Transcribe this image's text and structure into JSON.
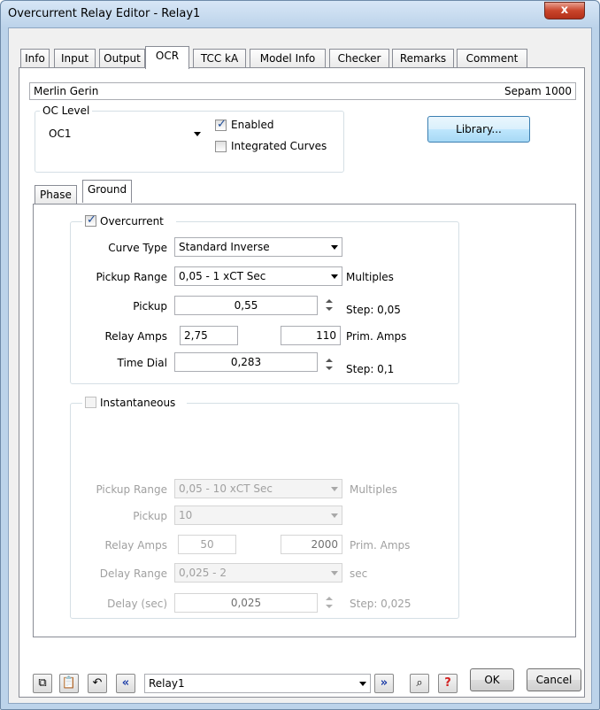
{
  "window": {
    "title": "Overcurrent Relay Editor - Relay1",
    "close_label": "x"
  },
  "tabs": [
    "Info",
    "Input",
    "Output",
    "OCR",
    "TCC kA",
    "Model Info",
    "Checker",
    "Remarks",
    "Comment"
  ],
  "active_tab": "OCR",
  "header": {
    "manufacturer": "Merlin Gerin",
    "model": "Sepam 1000"
  },
  "oc_level": {
    "group_label": "OC Level",
    "selected": "OC1",
    "enabled_label": "Enabled",
    "enabled_checked": true,
    "integrated_label": "Integrated Curves",
    "integrated_checked": false
  },
  "library_button": "Library...",
  "subtabs": [
    "Phase",
    "Ground"
  ],
  "active_subtab": "Ground",
  "overcurrent": {
    "label": "Overcurrent",
    "checked": true,
    "curve_type_label": "Curve Type",
    "curve_type": "Standard Inverse",
    "pickup_range_label": "Pickup Range",
    "pickup_range": "0,05 - 1  xCT Sec",
    "pickup_range_units": "Multiples",
    "pickup_label": "Pickup",
    "pickup": "0,55",
    "pickup_step": "Step: 0,05",
    "relay_amps_label": "Relay Amps",
    "relay_amps": "2,75",
    "prim_amps": "110",
    "prim_amps_label": "Prim. Amps",
    "time_dial_label": "Time Dial",
    "time_dial": "0,283",
    "time_dial_step": "Step: 0,1"
  },
  "instantaneous": {
    "label": "Instantaneous",
    "checked": false,
    "pickup_range_label": "Pickup Range",
    "pickup_range": "0,05 - 10  xCT Sec",
    "pickup_range_units": "Multiples",
    "pickup_label": "Pickup",
    "pickup": "10",
    "relay_amps_label": "Relay Amps",
    "relay_amps": "50",
    "prim_amps": "2000",
    "prim_amps_label": "Prim. Amps",
    "delay_range_label": "Delay Range",
    "delay_range": "0,025 - 2",
    "delay_range_units": "sec",
    "delay_label": "Delay (sec)",
    "delay": "0,025",
    "delay_step": "Step: 0,025"
  },
  "footer": {
    "relay_select": "Relay1",
    "ok_label": "OK",
    "cancel_label": "Cancel",
    "icons": [
      "copy-icon",
      "paste-icon",
      "undo-icon",
      "previous-icon",
      "next-icon",
      "find-icon",
      "help-icon"
    ]
  }
}
